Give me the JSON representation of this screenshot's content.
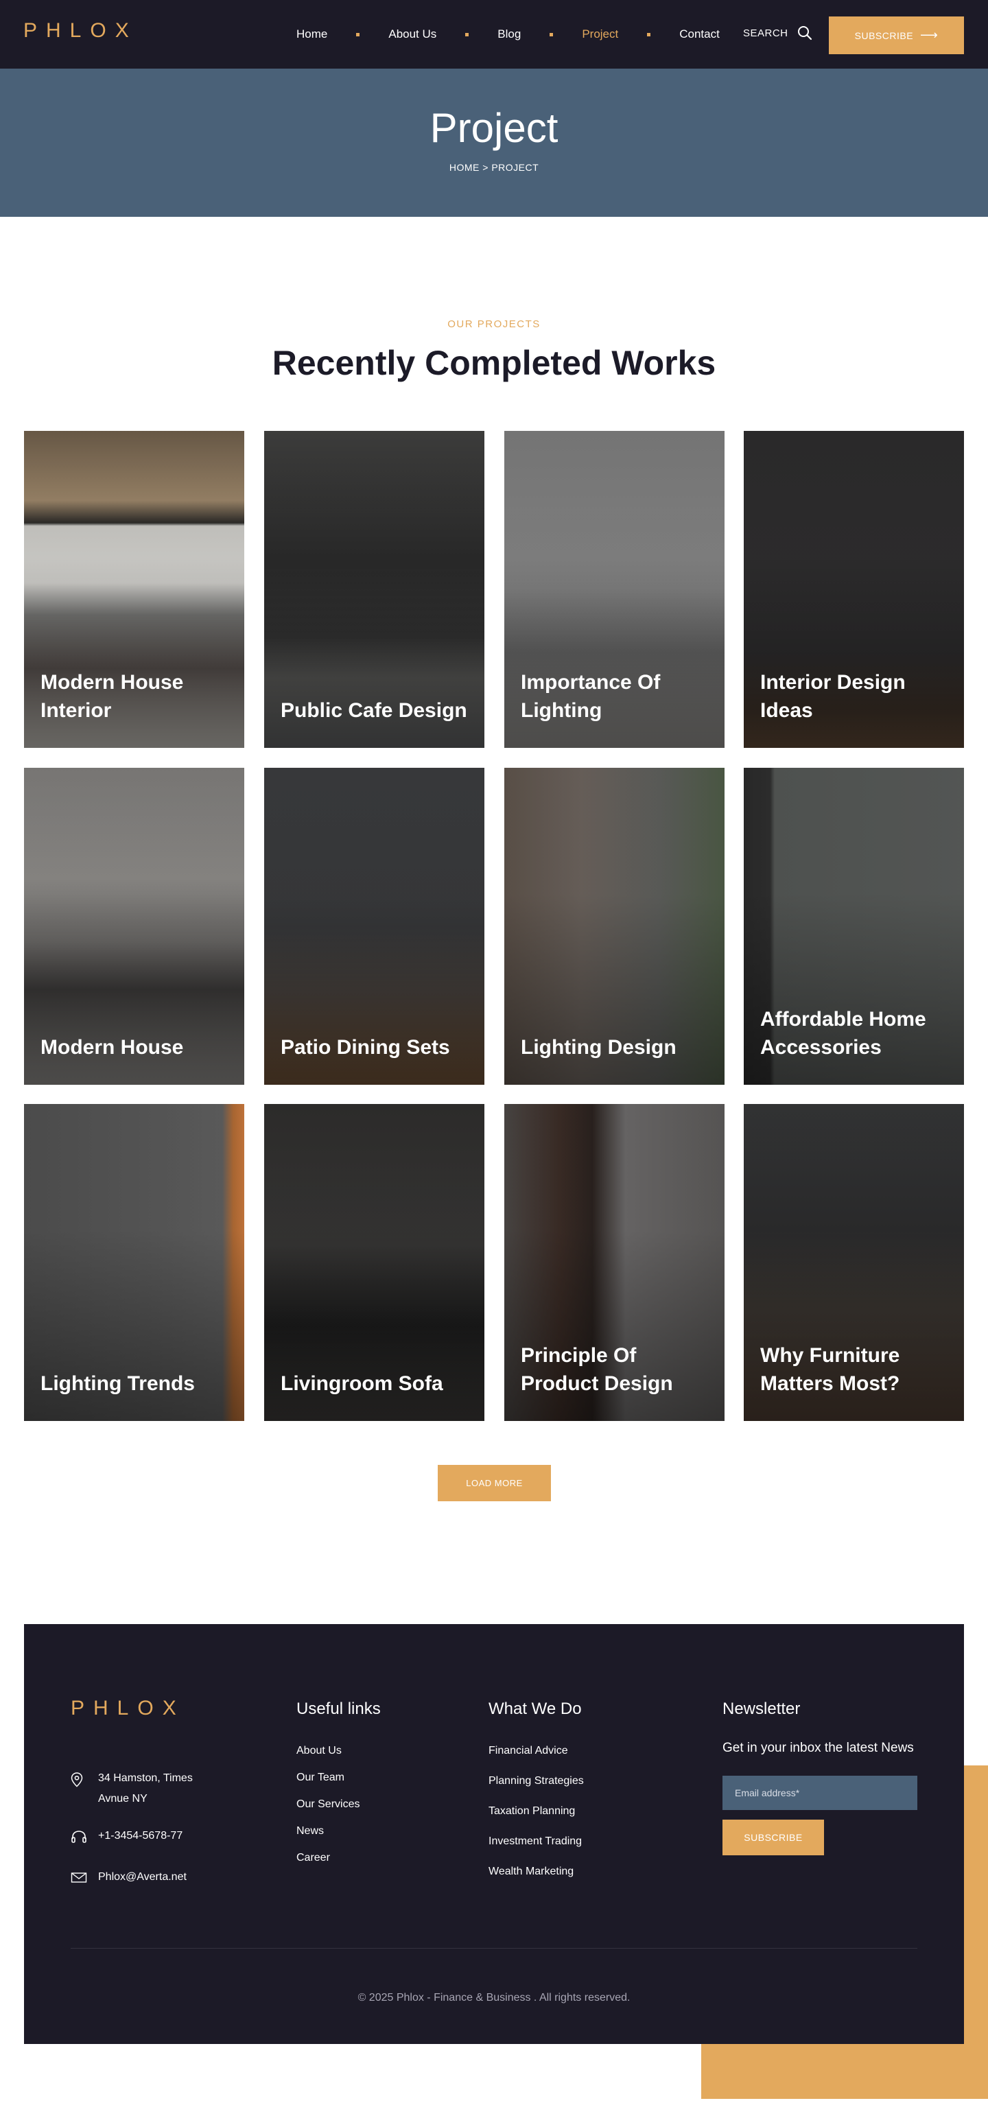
{
  "header": {
    "logo": "PHLOX",
    "nav": [
      {
        "label": "Home",
        "active": false
      },
      {
        "label": "About Us",
        "active": false
      },
      {
        "label": "Blog",
        "active": false
      },
      {
        "label": "Project",
        "active": true
      },
      {
        "label": "Contact",
        "active": false
      }
    ],
    "search_label": "SEARCH",
    "subscribe_label": "SUBSCRIBE",
    "subscribe_arrow": "⟶"
  },
  "hero": {
    "title": "Project",
    "breadcrumb_home": "HOME",
    "breadcrumb_sep": ">",
    "breadcrumb_current": "PROJECT"
  },
  "projects": {
    "eyebrow": "OUR PROJECTS",
    "title": "Recently Completed Works",
    "items": [
      {
        "title": "Modern House Interior"
      },
      {
        "title": "Public Cafe Design"
      },
      {
        "title": "Importance Of Lighting"
      },
      {
        "title": "Interior Design Ideas"
      },
      {
        "title": "Modern House"
      },
      {
        "title": "Patio Dining Sets"
      },
      {
        "title": "Lighting Design"
      },
      {
        "title": "Affordable Home Accessories"
      },
      {
        "title": "Lighting Trends"
      },
      {
        "title": "Livingroom Sofa"
      },
      {
        "title": "Principle Of Product Design"
      },
      {
        "title": "Why Furniture Matters Most?"
      }
    ],
    "load_more": "LOAD MORE"
  },
  "footer": {
    "logo": "PHLOX",
    "address_line1": "34 Hamston, Times",
    "address_line2": "Avnue NY",
    "phone": "+1-3454-5678-77",
    "email": "Phlox@Averta.net",
    "useful_links": {
      "heading": "Useful links",
      "items": [
        "About Us",
        "Our Team",
        "Our Services",
        "News",
        "Career"
      ]
    },
    "what_we_do": {
      "heading": "What We Do",
      "items": [
        "Financial Advice",
        "Planning Strategies",
        "Taxation Planning",
        "Investment Trading",
        "Wealth Marketing"
      ]
    },
    "newsletter": {
      "heading": "Newsletter",
      "text": "Get in your inbox the latest News",
      "placeholder": "Email address*",
      "button": "SUBSCRIBE"
    },
    "copyright": "© 2025 Phlox - Finance & Business . All rights reserved."
  },
  "colors": {
    "accent": "#e3a95d",
    "dark": "#1c1a27",
    "hero_blue": "#4a6178"
  }
}
